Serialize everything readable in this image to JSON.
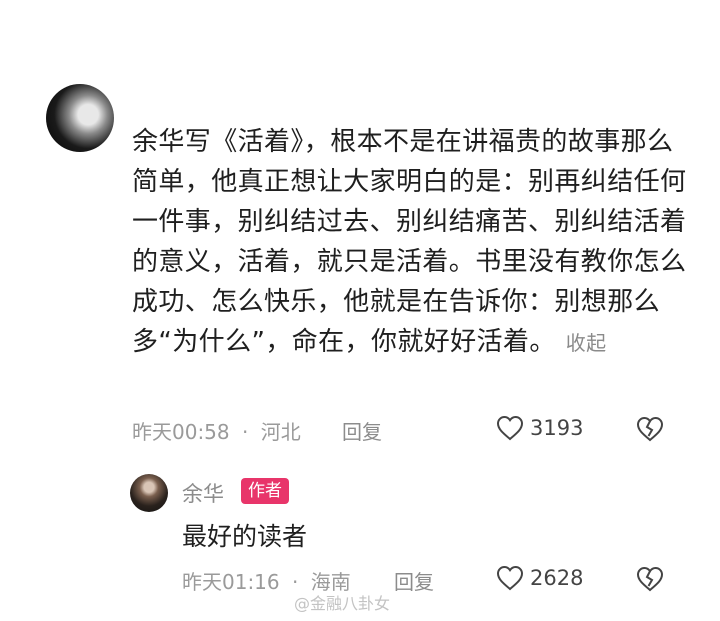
{
  "comment": {
    "text": "余华写《活着》，根本不是在讲福贵的故事那么简单，他真正想让大家明白的是：别再纠结任何一件事，别纠结过去、别纠结痛苦、别纠结活着的意义，活着，就只是活着。书里没有教你怎么成功、怎么快乐，他就是在告诉你：别想那么多“为什么”，命在，你就好好活着。",
    "collapse_label": "收起",
    "meta": {
      "time": "昨天00:58",
      "location": "河北"
    },
    "reply_label": "回复",
    "likes": "3193"
  },
  "reply": {
    "author_name": "余华",
    "author_badge": "作者",
    "text": "最好的读者",
    "meta": {
      "time": "昨天01:16",
      "location": "海南"
    },
    "reply_label": "回复",
    "likes": "2628"
  },
  "watermark": "@金融八卦女",
  "icons": [
    "heart-icon",
    "heart-broken-icon"
  ]
}
